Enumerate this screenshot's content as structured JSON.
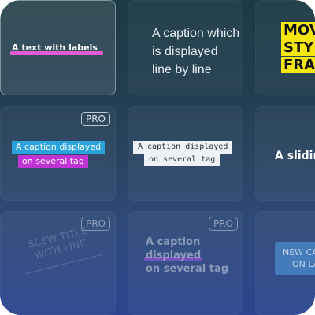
{
  "tiles": {
    "text_with_labels": {
      "text": "A text with labels",
      "highlight_color": "#e45bd2"
    },
    "line_by_line": {
      "lines": [
        "A caption which",
        "is displayed",
        "line by line"
      ]
    },
    "yellow_frames": {
      "lines": [
        "MOV",
        "STY",
        "FRA"
      ],
      "background": "#f5e60f"
    },
    "several_tag": {
      "badge": "PRO",
      "line1": "A caption displayed",
      "line1_color": "#2aa2de",
      "line2": "on several tag",
      "line2_color": "#c034d6"
    },
    "several_tag_mono": {
      "line1": "A caption displayed",
      "line2": "on several tag"
    },
    "sliding": {
      "text": "A slidin"
    },
    "skew_title": {
      "badge": "PRO",
      "lines": [
        "SCEW TITLE",
        "WITH LINE"
      ]
    },
    "faded_caption": {
      "badge": "PRO",
      "lines": [
        "A caption",
        "displayed",
        "on several tag"
      ]
    },
    "new_caption": {
      "lines": [
        "NEW CA",
        "ON LA"
      ]
    }
  }
}
